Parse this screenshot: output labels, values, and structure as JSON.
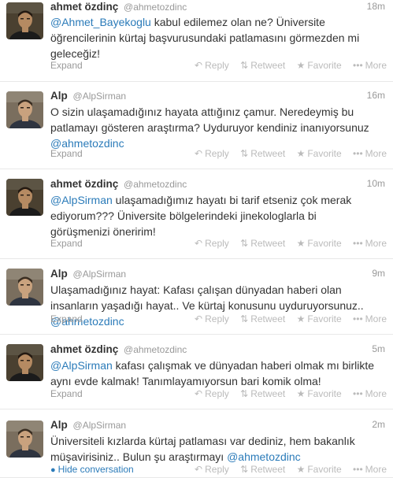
{
  "labels": {
    "expand": "Expand",
    "hide_conversation": "Hide conversation",
    "reply": "Reply",
    "retweet": "Retweet",
    "favorite": "Favorite",
    "more": "More"
  },
  "icons": {
    "reply": "reply-arrow-icon",
    "retweet": "retweet-icon",
    "favorite": "star-icon",
    "more": "ellipsis-icon",
    "hide": "speech-bubble-icon"
  },
  "colors": {
    "mention": "#2b7bb9",
    "muted": "#999999",
    "action": "#bbbbbb"
  },
  "tweets": [
    {
      "name": "ahmet özdinç",
      "handle": "@ahmetozdinc",
      "time": "18m",
      "segments": [
        {
          "text": "@Ahmet_Bayekoglu",
          "mention": true
        },
        {
          "text": " kabul edilemez olan ne? Üniversite öğrencilerinin kürtaj başvurusundaki patlamasını görmezden mi geleceğiz!",
          "mention": false
        }
      ]
    },
    {
      "name": "Alp",
      "handle": "@AlpSirman",
      "time": "16m",
      "segments": [
        {
          "text": "O sizin ulaşamadığınız hayata attığınız çamur. Neredeymiş bu patlamayı gösteren araştırma? Uyduruyor kendiniz inanıyorsunuz ",
          "mention": false
        },
        {
          "text": "@ahmetozdinc",
          "mention": true
        }
      ]
    },
    {
      "name": "ahmet özdinç",
      "handle": "@ahmetozdinc",
      "time": "10m",
      "segments": [
        {
          "text": "@AlpSirman",
          "mention": true
        },
        {
          "text": " ulaşamadığımız hayatı bi tarif etseniz çok merak ediyorum??? Üniversite bölgelerindeki jinekologlarla bi görüşmenizi öneririm!",
          "mention": false
        }
      ]
    },
    {
      "name": "Alp",
      "handle": "@AlpSirman",
      "time": "9m",
      "segments": [
        {
          "text": "Ulaşamadığınız hayat: Kafası çalışan dünyadan haberi olan insanların yaşadığı hayat.. Ve kürtaj konusunu uyduruyorsunuz.. ",
          "mention": false
        },
        {
          "text": "@ahmetozdinc",
          "mention": true
        }
      ]
    },
    {
      "name": "ahmet özdinç",
      "handle": "@ahmetozdinc",
      "time": "5m",
      "segments": [
        {
          "text": "@AlpSirman",
          "mention": true
        },
        {
          "text": " kafası çalışmak ve dünyadan haberi olmak mı birlikte aynı evde kalmak! Tanımlayamıyorsun bari komik olma!",
          "mention": false
        }
      ]
    },
    {
      "name": "Alp",
      "handle": "@AlpSirman",
      "time": "2m",
      "segments": [
        {
          "text": "Üniversiteli kızlarda kürtaj patlaması var dediniz, hem bakanlık müşavirisiniz.. Bulun şu araştırmayı ",
          "mention": false
        },
        {
          "text": "@ahmetozdinc",
          "mention": true
        }
      ]
    }
  ]
}
